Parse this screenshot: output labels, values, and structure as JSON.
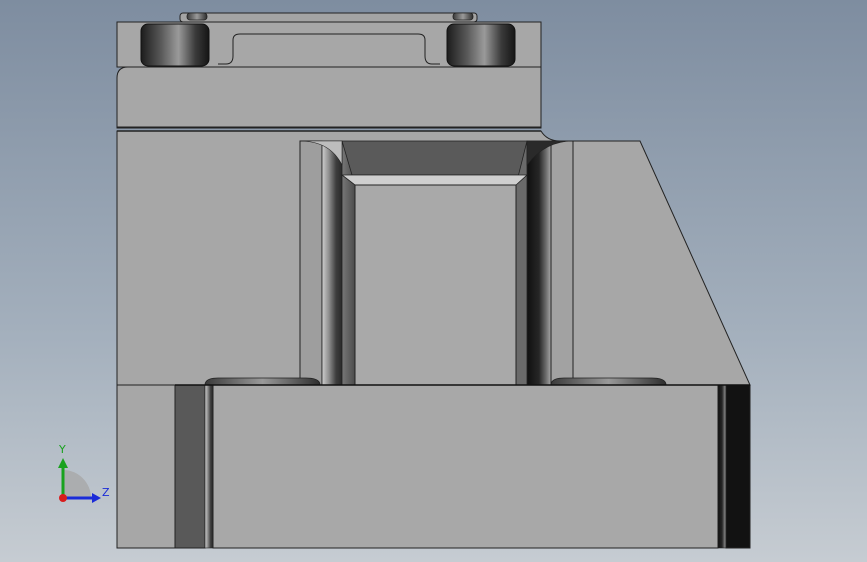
{
  "viewport": {
    "background_top": "#7e8da0",
    "background_bottom": "#c6ccd2"
  },
  "model": {
    "face_color": "#a7a7a7",
    "edge_color": "#1e1e1e",
    "shadow_color": "#0f0f0f"
  },
  "triad": {
    "y_label": "Y",
    "z_label": "Z",
    "y_color": "#19a21e",
    "z_color": "#1a2bd8",
    "x_color": "#d81c1c"
  }
}
